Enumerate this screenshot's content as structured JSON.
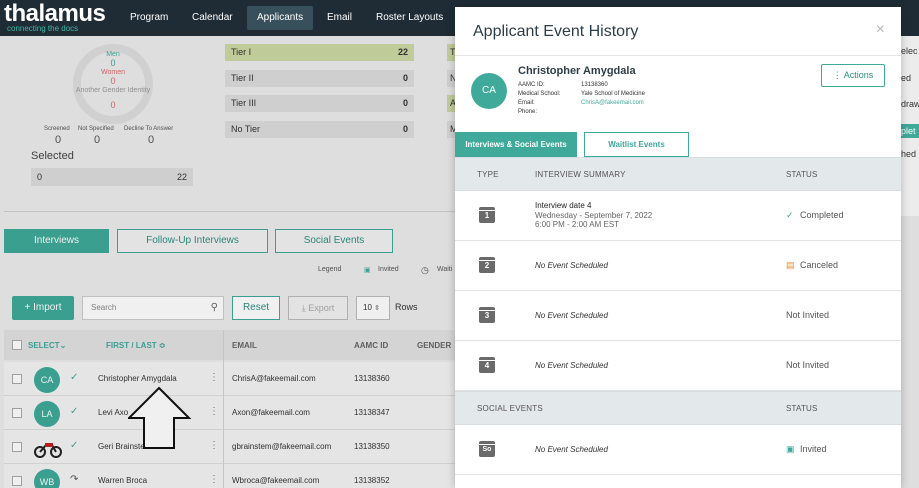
{
  "app": {
    "logo": "thalamus",
    "tagline": "connecting the docs",
    "nav": [
      {
        "label": "Program",
        "active": false
      },
      {
        "label": "Calendar",
        "active": false
      },
      {
        "label": "Applicants",
        "active": true
      },
      {
        "label": "Email",
        "active": false
      },
      {
        "label": "Roster Layouts",
        "active": false
      }
    ]
  },
  "background": {
    "gender": {
      "men_label": "Men",
      "men_count": "0",
      "women_label": "Women",
      "women_count": "0",
      "another_label": "Another Gender Identity",
      "another_count": "0"
    },
    "stats": [
      {
        "label": "Screened",
        "value": "0"
      },
      {
        "label": "Not Specified",
        "value": "0"
      },
      {
        "label": "Decline To Answer",
        "value": "0"
      }
    ],
    "selected": {
      "title": "Selected",
      "left": "0",
      "right": "22"
    },
    "tiers": [
      {
        "label": "Tier I",
        "count": "22",
        "edge": "T"
      },
      {
        "label": "Tier II",
        "count": "0",
        "edge": "N"
      },
      {
        "label": "Tier III",
        "count": "0",
        "edge": "A"
      },
      {
        "label": "No Tier",
        "count": "0",
        "edge": "M"
      }
    ],
    "right_edge": [
      "elec",
      "ed",
      "draw",
      "plet",
      "hed"
    ],
    "tabs": [
      "Interviews",
      "Follow-Up Interviews",
      "Social Events"
    ],
    "legend": {
      "label": "Legend",
      "invited": "Invited",
      "waitlist": "Waiti"
    },
    "toolbar": {
      "import": "Import",
      "search_placeholder": "Search",
      "reset": "Reset",
      "export": "Export",
      "rows_value": "10",
      "rows_label": "Rows"
    },
    "table": {
      "headers": {
        "select": "Select",
        "name": "First / Last",
        "email": "Email",
        "aamc": "AAMC ID",
        "gender": "Gender"
      },
      "rows": [
        {
          "initials": "CA",
          "mark": "✓",
          "name": "Christopher Amygdala",
          "email": "ChrisA@fakeemail.com",
          "aamc": "13138360"
        },
        {
          "initials": "LA",
          "mark": "✓",
          "name": "Levi Axo",
          "email": "Axon@fakeemail.com",
          "aamc": "13138347"
        },
        {
          "initials": "",
          "mark": "✓",
          "name": "Geri Brainstem",
          "email": "gbrainstem@fakeemail.com",
          "aamc": "13138350"
        },
        {
          "initials": "WB",
          "mark": "↷",
          "name": "Warren Broca",
          "email": "Wbroca@fakeemail.com",
          "aamc": "13138352"
        }
      ]
    }
  },
  "modal": {
    "title": "Applicant Event History",
    "close": "×",
    "applicant": {
      "initials": "CA",
      "name": "Christopher Amygdala",
      "fields": [
        {
          "key": "AAMC ID:",
          "value": "13138360"
        },
        {
          "key": "Medical School:",
          "value": "Yale School of Medicine"
        },
        {
          "key": "Email:",
          "value": "ChrisA@fakeemail.com"
        },
        {
          "key": "Phone:",
          "value": ""
        }
      ]
    },
    "actions_label": "Actions",
    "tabs": [
      {
        "label": "Interviews & Social Events",
        "active": true
      },
      {
        "label": "Waitlist Events",
        "active": false
      }
    ],
    "interview_headers": {
      "type": "Type",
      "summary": "Interview Summary",
      "status": "Status"
    },
    "interviews": [
      {
        "day": "1",
        "title": "Interview date 4",
        "line2": "Wednesday - September 7, 2022",
        "line3": "6:00 PM - 2:00 AM EST",
        "status": "Completed",
        "status_icon": "check-icon"
      },
      {
        "day": "2",
        "title": "No Event Scheduled",
        "status": "Canceled",
        "status_icon": "calendar-cancel-icon"
      },
      {
        "day": "3",
        "title": "No Event Scheduled",
        "status": "Not Invited",
        "status_icon": ""
      },
      {
        "day": "4",
        "title": "No Event Scheduled",
        "status": "Not Invited",
        "status_icon": ""
      }
    ],
    "social_headers": {
      "type": "Social Events",
      "status": "Status"
    },
    "social": [
      {
        "day": "So",
        "title": "No Event Scheduled",
        "status": "Invited",
        "status_icon": "calendar-invite-icon"
      }
    ],
    "colors": {
      "accent": "#3fa99a",
      "nav": "#1f2c36",
      "canceled": "#e88a2e"
    }
  }
}
